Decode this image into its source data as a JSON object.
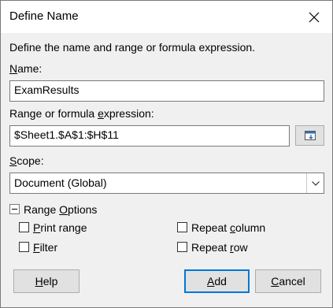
{
  "dialog": {
    "title": "Define Name",
    "instruction": "Define the name and range or formula expression."
  },
  "name": {
    "label_underlined": "N",
    "label_rest": "ame:",
    "value": "ExamResults"
  },
  "range": {
    "label_before": "Range or formula ",
    "label_underlined": "e",
    "label_after": "xpression:",
    "value": "$Sheet1.$A$1:$H$11",
    "shrink_icon": "shrink-range-icon"
  },
  "scope": {
    "label_underlined": "S",
    "label_rest": "cope:",
    "selected": "Document (Global)"
  },
  "range_options": {
    "label_before": "Range ",
    "label_underlined": "O",
    "label_after": "ptions",
    "print_range": {
      "underlined": "P",
      "rest": "rint range",
      "checked": false
    },
    "filter": {
      "underlined": "F",
      "rest": "ilter",
      "checked": false
    },
    "repeat_column": {
      "before": "Repeat ",
      "underlined": "c",
      "after": "olumn",
      "checked": false
    },
    "repeat_row": {
      "before": "Repeat ",
      "underlined": "r",
      "after": "ow",
      "checked": false
    }
  },
  "buttons": {
    "help": {
      "underlined": "H",
      "rest": "elp"
    },
    "add": {
      "underlined": "A",
      "rest": "dd"
    },
    "cancel": {
      "underlined": "C",
      "rest": "ancel"
    }
  },
  "colors": {
    "accent": "#0078d7",
    "dialog_bg": "#f0f0f0",
    "button_bg": "#e1e1e1"
  }
}
